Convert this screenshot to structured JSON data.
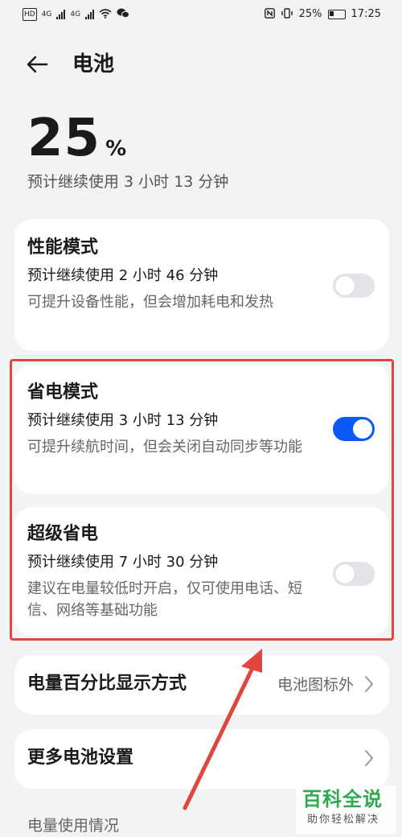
{
  "status_bar": {
    "left_badge": "HD",
    "network_left": "4G",
    "network_right": "4G",
    "battery": "25%",
    "time": "17:25"
  },
  "header": {
    "title": "电池"
  },
  "battery": {
    "percent": "25",
    "unit": "%",
    "estimate": "预计继续使用 3 小时 13 分钟"
  },
  "modes": [
    {
      "title": "性能模式",
      "estimate": "预计继续使用 2 小时 46 分钟",
      "desc": "可提升设备性能，但会增加耗电和发热",
      "enabled": false
    },
    {
      "title": "省电模式",
      "estimate": "预计继续使用 3 小时 13 分钟",
      "desc": "可提升续航时间，但会关闭自动同步等功能",
      "enabled": true
    },
    {
      "title": "超级省电",
      "estimate": "预计继续使用 7 小时 30 分钟",
      "desc": "建议在电量较低时开启，仅可使用电话、短信、网络等基础功能",
      "enabled": false
    }
  ],
  "rows": [
    {
      "title": "电量百分比显示方式",
      "value": "电池图标外"
    },
    {
      "title": "更多电池设置",
      "value": ""
    }
  ],
  "section_label": "电量使用情况",
  "watermark": {
    "main": "百科全说",
    "sub": "助你轻松解决"
  },
  "colors": {
    "accent": "#0a59f7",
    "highlight": "#e0463d",
    "watermark": "#2fa84f"
  }
}
